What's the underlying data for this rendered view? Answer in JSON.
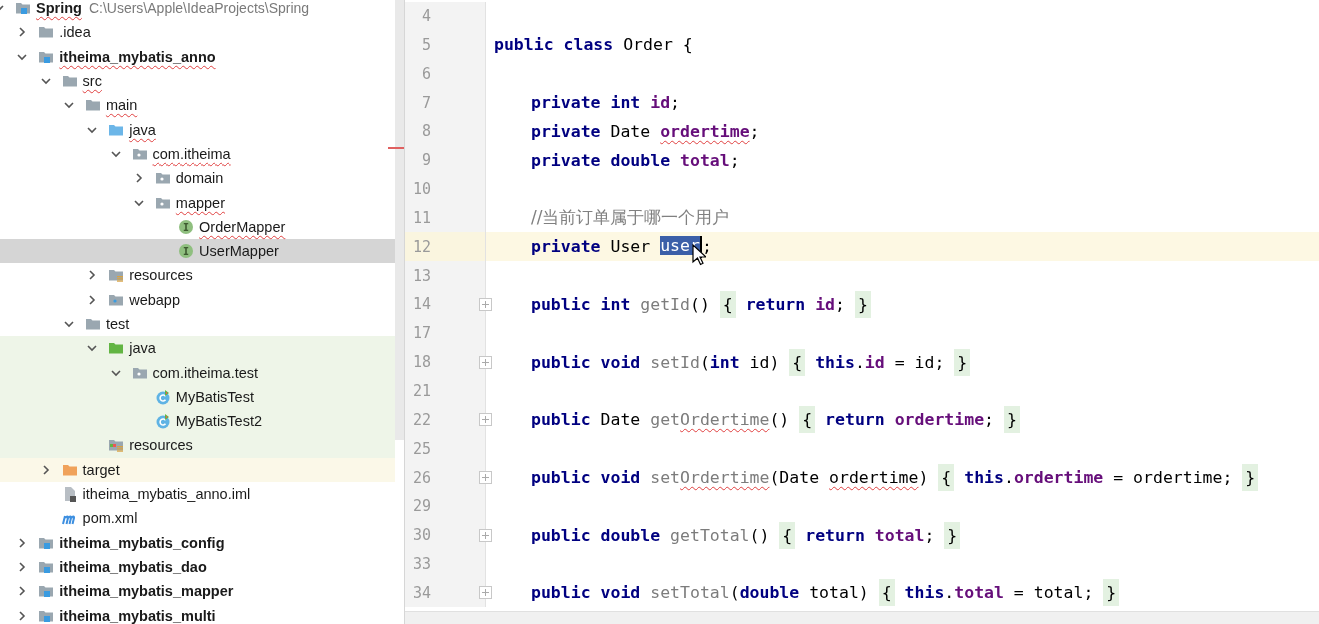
{
  "project_tree": {
    "items": [
      {
        "label": "Spring",
        "kind": "module",
        "path": "C:\\Users\\Apple\\IdeaProjects\\Spring",
        "expanded": true,
        "selected": false,
        "typo": true,
        "children": [
          {
            "label": ".idea",
            "kind": "folder",
            "expanded": false,
            "selected": false
          },
          {
            "label": "itheima_mybatis_anno",
            "kind": "module",
            "expanded": true,
            "selected": false,
            "typo": true,
            "children": [
              {
                "label": "src",
                "kind": "folder",
                "expanded": true,
                "selected": false,
                "typo": true,
                "children": [
                  {
                    "label": "main",
                    "kind": "folder",
                    "expanded": true,
                    "selected": false,
                    "typo": true,
                    "children": [
                      {
                        "label": "java",
                        "kind": "source-folder",
                        "expanded": true,
                        "selected": false,
                        "typo": true,
                        "children": [
                          {
                            "label": "com.itheima",
                            "kind": "package",
                            "expanded": true,
                            "selected": false,
                            "typo": true,
                            "children": [
                              {
                                "label": "domain",
                                "kind": "package",
                                "expanded": false,
                                "selected": false
                              },
                              {
                                "label": "mapper",
                                "kind": "package",
                                "expanded": true,
                                "selected": false,
                                "typo": true,
                                "children": [
                                  {
                                    "label": "OrderMapper",
                                    "kind": "interface",
                                    "selected": false,
                                    "typo": true
                                  },
                                  {
                                    "label": "UserMapper",
                                    "kind": "interface",
                                    "selected": true
                                  }
                                ]
                              }
                            ]
                          }
                        ]
                      },
                      {
                        "label": "resources",
                        "kind": "resources",
                        "expanded": false,
                        "selected": false
                      },
                      {
                        "label": "webapp",
                        "kind": "web-folder",
                        "expanded": false,
                        "selected": false
                      }
                    ]
                  },
                  {
                    "label": "test",
                    "kind": "folder",
                    "expanded": true,
                    "selected": false,
                    "children": [
                      {
                        "label": "java",
                        "kind": "test-folder",
                        "expanded": true,
                        "selected": false,
                        "test_scope": true,
                        "children": [
                          {
                            "label": "com.itheima.test",
                            "kind": "package",
                            "expanded": true,
                            "selected": false,
                            "test_scope": true,
                            "children": [
                              {
                                "label": "MyBatisTest",
                                "kind": "test-class",
                                "selected": false,
                                "test_scope": true
                              },
                              {
                                "label": "MyBatisTest2",
                                "kind": "test-class",
                                "selected": false,
                                "test_scope": true
                              }
                            ]
                          }
                        ]
                      },
                      {
                        "label": "resources",
                        "kind": "test-resources",
                        "selected": false,
                        "test_scope": true
                      }
                    ]
                  }
                ]
              },
              {
                "label": "target",
                "kind": "excluded-folder",
                "expanded": false,
                "selected": false,
                "excluded": true
              },
              {
                "label": "itheima_mybatis_anno.iml",
                "kind": "iml",
                "selected": false
              },
              {
                "label": "pom.xml",
                "kind": "maven",
                "selected": false
              }
            ]
          },
          {
            "label": "itheima_mybatis_config",
            "kind": "module",
            "expanded": false,
            "selected": false
          },
          {
            "label": "itheima_mybatis_dao",
            "kind": "module",
            "expanded": false,
            "selected": false
          },
          {
            "label": "itheima_mybatis_mapper",
            "kind": "module",
            "expanded": false,
            "selected": false
          },
          {
            "label": "itheima_mybatis_multi",
            "kind": "module",
            "expanded": false,
            "selected": false
          }
        ]
      }
    ]
  },
  "editor": {
    "lines": [
      {
        "number": "4"
      },
      {
        "number": "5",
        "tokens": [
          {
            "text": "public class",
            "kind": "keyword"
          },
          {
            "text": " Order {",
            "kind": "plain"
          }
        ]
      },
      {
        "number": "6"
      },
      {
        "number": "7",
        "indented": true,
        "tokens": [
          {
            "text": "private int",
            "kind": "keyword"
          },
          {
            "text": " id",
            "kind": "field"
          },
          {
            "text": ";",
            "kind": "plain"
          }
        ]
      },
      {
        "number": "8",
        "indented": true,
        "tokens": [
          {
            "text": "private",
            "kind": "keyword"
          },
          {
            "text": " Date ",
            "kind": "plain"
          },
          {
            "text": "ordertime",
            "kind": "field",
            "typo": true
          },
          {
            "text": ";",
            "kind": "plain"
          }
        ]
      },
      {
        "number": "9",
        "indented": true,
        "tokens": [
          {
            "text": "private double",
            "kind": "keyword"
          },
          {
            "text": " total",
            "kind": "field"
          },
          {
            "text": ";",
            "kind": "plain"
          }
        ]
      },
      {
        "number": "10"
      },
      {
        "number": "11",
        "indented": true,
        "tokens": [
          {
            "text": "//当前订单属于哪一个用户",
            "kind": "comment"
          }
        ]
      },
      {
        "number": "12",
        "indented": true,
        "current": true,
        "tokens": [
          {
            "text": "private",
            "kind": "keyword"
          },
          {
            "text": " User ",
            "kind": "plain"
          },
          {
            "text": "user",
            "kind": "selection"
          },
          {
            "text": ";",
            "kind": "plain"
          }
        ]
      },
      {
        "number": "13"
      },
      {
        "number": "14",
        "indented": true,
        "folded": true,
        "tokens": [
          {
            "text": "public int",
            "kind": "keyword"
          },
          {
            "text": " getId",
            "kind": "method"
          },
          {
            "text": "() ",
            "kind": "plain"
          },
          {
            "text": "{",
            "kind": "brace"
          },
          {
            "text": " return",
            "kind": "keyword"
          },
          {
            "text": " id",
            "kind": "field"
          },
          {
            "text": "; ",
            "kind": "plain"
          },
          {
            "text": "}",
            "kind": "brace"
          }
        ]
      },
      {
        "number": "17"
      },
      {
        "number": "18",
        "indented": true,
        "folded": true,
        "tokens": [
          {
            "text": "public void",
            "kind": "keyword"
          },
          {
            "text": " setId",
            "kind": "method"
          },
          {
            "text": "(",
            "kind": "plain"
          },
          {
            "text": "int",
            "kind": "keyword"
          },
          {
            "text": " id) ",
            "kind": "plain"
          },
          {
            "text": "{",
            "kind": "brace"
          },
          {
            "text": " this",
            "kind": "keyword"
          },
          {
            "text": ".",
            "kind": "plain"
          },
          {
            "text": "id",
            "kind": "field"
          },
          {
            "text": " = id; ",
            "kind": "plain"
          },
          {
            "text": "}",
            "kind": "brace"
          }
        ]
      },
      {
        "number": "21"
      },
      {
        "number": "22",
        "indented": true,
        "folded": true,
        "tokens": [
          {
            "text": "public",
            "kind": "keyword"
          },
          {
            "text": " Date ",
            "kind": "plain"
          },
          {
            "text": "get",
            "kind": "method"
          },
          {
            "text": "Ordertime",
            "kind": "method",
            "typo": true
          },
          {
            "text": "() ",
            "kind": "plain"
          },
          {
            "text": "{",
            "kind": "brace"
          },
          {
            "text": " return",
            "kind": "keyword"
          },
          {
            "text": " ordertime",
            "kind": "field"
          },
          {
            "text": "; ",
            "kind": "plain"
          },
          {
            "text": "}",
            "kind": "brace"
          }
        ]
      },
      {
        "number": "25"
      },
      {
        "number": "26",
        "indented": true,
        "folded": true,
        "tokens": [
          {
            "text": "public void",
            "kind": "keyword"
          },
          {
            "text": " set",
            "kind": "method"
          },
          {
            "text": "Ordertime",
            "kind": "method",
            "typo": true
          },
          {
            "text": "(Date ",
            "kind": "plain"
          },
          {
            "text": "ordertime",
            "kind": "plain",
            "typo": true
          },
          {
            "text": ") ",
            "kind": "plain"
          },
          {
            "text": "{",
            "kind": "brace"
          },
          {
            "text": " this",
            "kind": "keyword"
          },
          {
            "text": ".",
            "kind": "plain"
          },
          {
            "text": "ordertime",
            "kind": "field"
          },
          {
            "text": " = ordertime; ",
            "kind": "plain"
          },
          {
            "text": "}",
            "kind": "brace"
          }
        ]
      },
      {
        "number": "29"
      },
      {
        "number": "30",
        "indented": true,
        "folded": true,
        "tokens": [
          {
            "text": "public double",
            "kind": "keyword"
          },
          {
            "text": " getTotal",
            "kind": "method"
          },
          {
            "text": "() ",
            "kind": "plain"
          },
          {
            "text": "{",
            "kind": "brace"
          },
          {
            "text": " return",
            "kind": "keyword"
          },
          {
            "text": " total",
            "kind": "field"
          },
          {
            "text": "; ",
            "kind": "plain"
          },
          {
            "text": "}",
            "kind": "brace"
          }
        ]
      },
      {
        "number": "33"
      },
      {
        "number": "34",
        "indented": true,
        "folded": true,
        "tokens": [
          {
            "text": "public void",
            "kind": "keyword"
          },
          {
            "text": " setTotal",
            "kind": "method"
          },
          {
            "text": "(",
            "kind": "plain"
          },
          {
            "text": "double",
            "kind": "keyword"
          },
          {
            "text": " total) ",
            "kind": "plain"
          },
          {
            "text": "{",
            "kind": "brace"
          },
          {
            "text": " this",
            "kind": "keyword"
          },
          {
            "text": ".",
            "kind": "plain"
          },
          {
            "text": "total",
            "kind": "field"
          },
          {
            "text": " = total; ",
            "kind": "plain"
          },
          {
            "text": "}",
            "kind": "brace"
          }
        ]
      }
    ]
  }
}
